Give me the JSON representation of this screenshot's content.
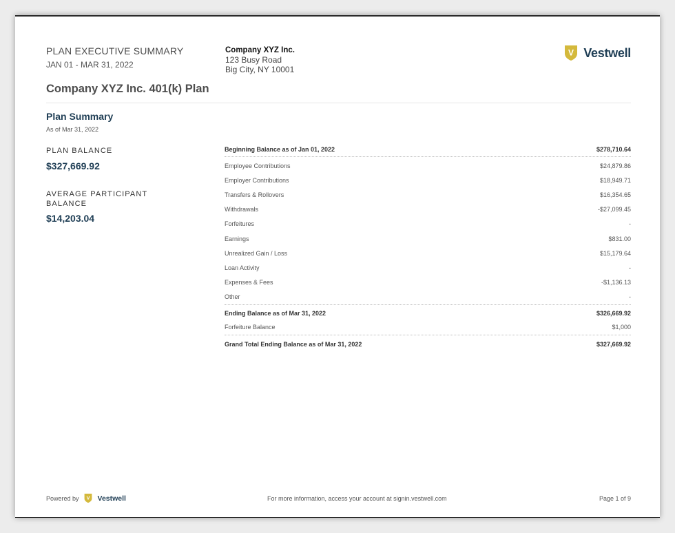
{
  "header": {
    "title": "PLAN EXECUTIVE SUMMARY",
    "period": "JAN 01 - MAR 31, 2022",
    "company": "Company XYZ Inc.",
    "address1": "123 Busy Road",
    "address2": "Big City, NY 10001",
    "brand": "Vestwell",
    "brand_letter": "V"
  },
  "plan_name": "Company XYZ Inc. 401(k) Plan",
  "summary": {
    "title": "Plan Summary",
    "as_of": "As of Mar 31, 2022",
    "plan_balance_label": "PLAN BALANCE",
    "plan_balance": "$327,669.92",
    "avg_label_line1": "AVERAGE PARTICIPANT",
    "avg_label_line2": "BALANCE",
    "avg_balance": "$14,203.04"
  },
  "table": {
    "beginning": {
      "label": "Beginning Balance as of Jan 01, 2022",
      "value": "$278,710.64"
    },
    "items": [
      {
        "label": "Employee Contributions",
        "value": "$24,879.86"
      },
      {
        "label": "Employer Contributions",
        "value": "$18,949.71"
      },
      {
        "label": "Transfers & Rollovers",
        "value": "$16,354.65"
      },
      {
        "label": "Withdrawals",
        "value": "-$27,099.45"
      },
      {
        "label": "Forfeitures",
        "value": "-"
      },
      {
        "label": "Earnings",
        "value": "$831.00"
      },
      {
        "label": "Unrealized Gain / Loss",
        "value": "$15,179.64"
      },
      {
        "label": "Loan Activity",
        "value": "-"
      },
      {
        "label": "Expenses & Fees",
        "value": "-$1,136.13"
      },
      {
        "label": "Other",
        "value": "-"
      }
    ],
    "ending": {
      "label": "Ending Balance as of Mar 31, 2022",
      "value": "$326,669.92"
    },
    "forfeiture": {
      "label": "Forfeiture Balance",
      "value": "$1,000"
    },
    "grand": {
      "label": "Grand Total Ending Balance as of Mar 31, 2022",
      "value": "$327,669.92"
    }
  },
  "footer": {
    "powered_by": "Powered by",
    "brand": "Vestwell",
    "info": "For more information, access your account at signin.vestwell.com",
    "page": "Page 1 of 9"
  },
  "colors": {
    "brand_navy": "#1f3e55",
    "brand_gold": "#d4b93c"
  }
}
